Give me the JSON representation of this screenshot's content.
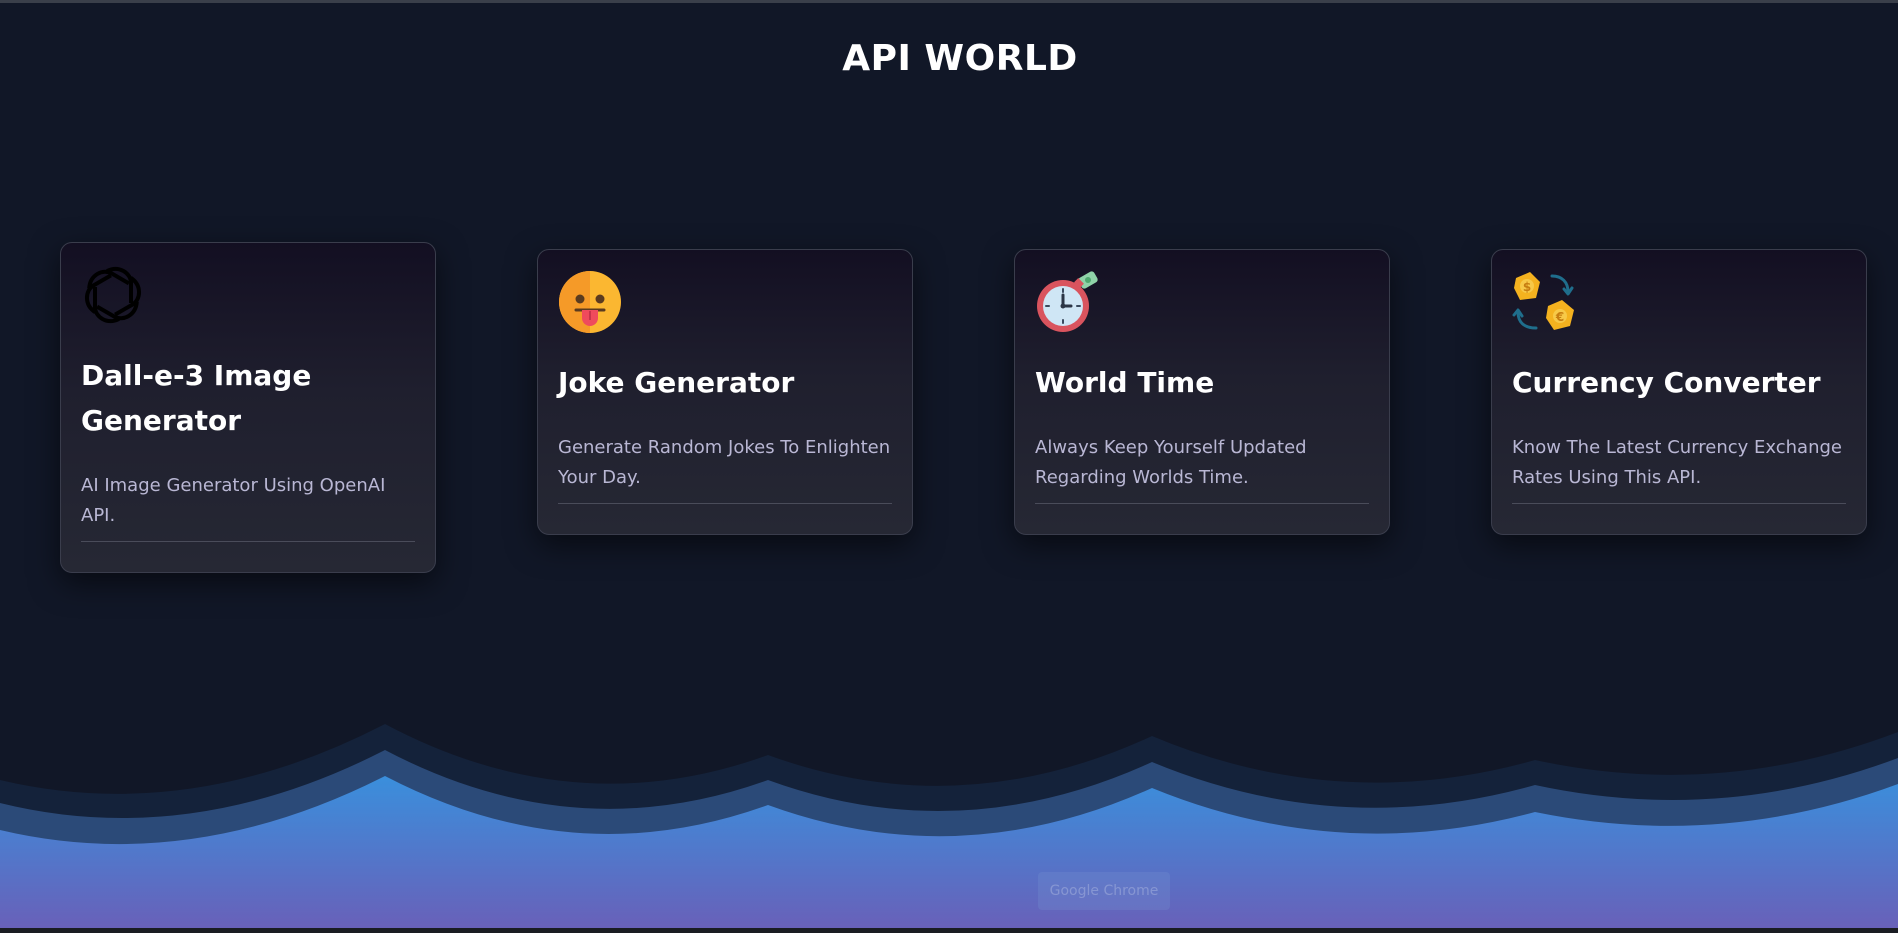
{
  "site": {
    "title": "API WORLD"
  },
  "cards": [
    {
      "icon": "openai-logo-icon",
      "title": "Dall-e-3 Image Generator",
      "description": "AI Image Generator Using OpenAI API."
    },
    {
      "icon": "tongue-out-face-icon",
      "title": "Joke Generator",
      "description": "Generate Random Jokes To Enlighten Your Day."
    },
    {
      "icon": "stopwatch-globe-icon",
      "title": "World Time",
      "description": "Always Keep Yourself Updated Regarding Worlds Time."
    },
    {
      "icon": "currency-exchange-icon",
      "title": "Currency Converter",
      "description": "Know The Latest Currency Exchange Rates Using This API."
    }
  ],
  "taskbar_tooltip": {
    "label": "Google Chrome"
  },
  "colors": {
    "background": "#111727",
    "card_border": "#3a3d4c",
    "description_text": "#b9b7d4",
    "wave_front_top": "#3a8fdc",
    "wave_front_bottom": "#6a5fb8"
  }
}
